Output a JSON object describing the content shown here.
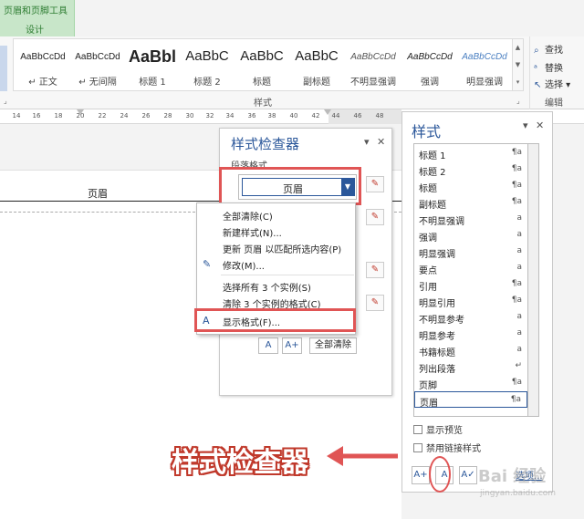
{
  "ribbon": {
    "contextual_tab": {
      "group": "页眉和页脚工具",
      "tab": "设计"
    },
    "styles_group_label": "样式",
    "editing_group_label": "编辑",
    "gallery": [
      {
        "preview": "AaBbCcDd",
        "name": "↵ 正文"
      },
      {
        "preview": "AaBbCcDd",
        "name": "↵ 无间隔"
      },
      {
        "preview": "AaBbl",
        "name": "标题 1"
      },
      {
        "preview": "AaBbC",
        "name": "标题 2"
      },
      {
        "preview": "AaBbC",
        "name": "标题"
      },
      {
        "preview": "AaBbC",
        "name": "副标题"
      },
      {
        "preview": "AaBbCcDd",
        "name": "不明显强调"
      },
      {
        "preview": "AaBbCcDd",
        "name": "强调"
      },
      {
        "preview": "AaBbCcDd",
        "name": "明显强调"
      }
    ],
    "editing": {
      "find": "查找",
      "replace": "替换",
      "select": "选择"
    }
  },
  "ruler": {
    "ticks": [
      "14",
      "16",
      "18",
      "20",
      "22",
      "24",
      "26",
      "28",
      "30",
      "32",
      "34",
      "36",
      "38",
      "40",
      "42",
      "44",
      "46",
      "48"
    ]
  },
  "document": {
    "header_text": "页眉"
  },
  "style_inspector": {
    "title": "样式检查器",
    "paragraph_label": "段落格式",
    "current_style": "页眉",
    "clear_all": "全部清除"
  },
  "context_menu": {
    "items": [
      "全部清除(C)",
      "新建样式(N)...",
      "更新 页眉 以匹配所选内容(P)",
      "修改(M)...",
      "选择所有 3 个实例(S)",
      "清除 3 个实例的格式(C)",
      "显示格式(F)..."
    ]
  },
  "styles_pane": {
    "title": "样式",
    "items": [
      {
        "label": "标题 1",
        "symbol": "¶a"
      },
      {
        "label": "标题 2",
        "symbol": "¶a"
      },
      {
        "label": "标题",
        "symbol": "¶a"
      },
      {
        "label": "副标题",
        "symbol": "¶a"
      },
      {
        "label": "不明显强调",
        "symbol": "a"
      },
      {
        "label": "强调",
        "symbol": "a"
      },
      {
        "label": "明显强调",
        "symbol": "a"
      },
      {
        "label": "要点",
        "symbol": "a"
      },
      {
        "label": "引用",
        "symbol": "¶a"
      },
      {
        "label": "明显引用",
        "symbol": "¶a"
      },
      {
        "label": "不明显参考",
        "symbol": "a"
      },
      {
        "label": "明显参考",
        "symbol": "a"
      },
      {
        "label": "书籍标题",
        "symbol": "a"
      },
      {
        "label": "列出段落",
        "symbol": "↵"
      },
      {
        "label": "页脚",
        "symbol": "¶a"
      },
      {
        "label": "页眉",
        "symbol": "¶a"
      }
    ],
    "show_preview": "显示预览",
    "disable_linked": "禁用链接样式",
    "options": "选项..."
  },
  "annotation": {
    "text": "样式检查器"
  },
  "watermark": {
    "text": "Bai 经验",
    "sub": "jingyan.baidu.com"
  },
  "colors": {
    "accent": "#2b579a",
    "highlight": "#e05555",
    "contextual": "#c8e6c9"
  }
}
